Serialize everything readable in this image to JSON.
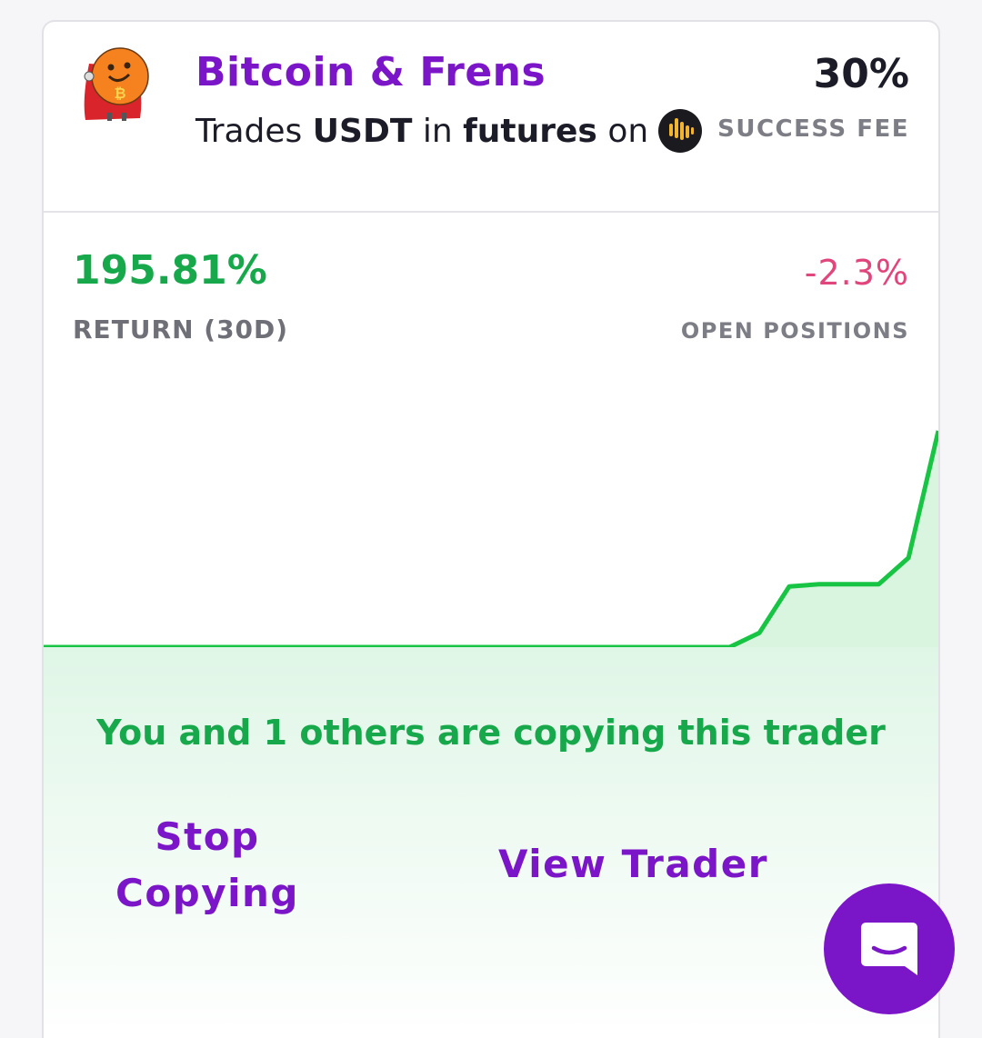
{
  "trader": {
    "name": "Bitcoin & Frens",
    "avatar_icon": "bitcoin-hero-mascot-icon",
    "trades_prefix": "Trades",
    "asset": "USDT",
    "trades_in": "in",
    "market": "futures",
    "trades_on": "on",
    "exchange_icon": "exchange-logo-icon"
  },
  "fee": {
    "value": "30%",
    "label": "SUCCESS FEE"
  },
  "stats": {
    "return_value": "195.81%",
    "return_label": "RETURN (30D)",
    "open_value": "-2.3%",
    "open_label": "OPEN POSITIONS"
  },
  "chart_data": {
    "type": "area",
    "x": [
      1,
      2,
      3,
      4,
      5,
      6,
      7,
      8,
      9,
      10,
      11,
      12,
      13,
      14,
      15,
      16,
      17,
      18,
      19,
      20,
      21,
      22,
      23,
      24,
      25,
      26,
      27,
      28,
      29,
      30,
      31
    ],
    "values": [
      0,
      0,
      0,
      0,
      0,
      0,
      0,
      0,
      0,
      0,
      0,
      0,
      0,
      0,
      0,
      0,
      0,
      0,
      0,
      0,
      0,
      0,
      0,
      0,
      0.13,
      0.55,
      0.57,
      0.57,
      0.57,
      0.81,
      1.96
    ],
    "line_color": "#18c443",
    "fill_color": "#d9f5e0"
  },
  "copying": {
    "text": "You and 1 others are copying this trader"
  },
  "actions": {
    "stop_label": "Stop Copying",
    "view_label": "View Trader"
  },
  "colors": {
    "brand": "#7b16c8",
    "positive": "#18a84c",
    "negative": "#e0457b"
  },
  "chat": {
    "icon": "chat-bubble-icon"
  }
}
